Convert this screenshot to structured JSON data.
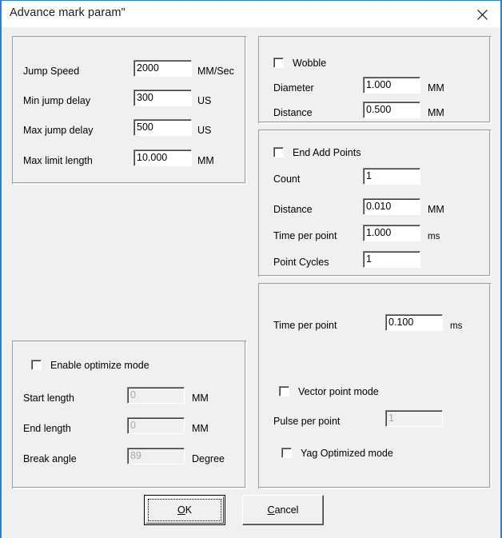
{
  "window": {
    "title": "Advance mark param\"",
    "close_icon": "close-icon",
    "accent_color": "#2f7fd1",
    "face_color": "#f0f0f0",
    "titlebar_color": "#ffffff"
  },
  "jump_group": {
    "rows": [
      {
        "label": "Jump Speed",
        "value": "2000",
        "unit": "MM/Sec",
        "disabled": false
      },
      {
        "label": "Min jump delay",
        "value": "300",
        "unit": "US",
        "disabled": false
      },
      {
        "label": "Max jump delay",
        "value": "500",
        "unit": "US",
        "disabled": false
      },
      {
        "label": "Max limit length",
        "value": "10.000",
        "unit": "MM",
        "disabled": false
      }
    ]
  },
  "wobble_group": {
    "checkbox": {
      "label": "Wobble",
      "checked": false
    },
    "rows": [
      {
        "label": "Diameter",
        "value": "1.000",
        "unit": "MM",
        "disabled": false
      },
      {
        "label": "Distance",
        "value": "0.500",
        "unit": "MM",
        "disabled": false
      }
    ]
  },
  "end_add_points_group": {
    "checkbox": {
      "label": "End Add Points",
      "checked": false
    },
    "rows": [
      {
        "label": "Count",
        "value": "1",
        "unit": "",
        "disabled": false
      },
      {
        "label": "Distance",
        "value": "0.010",
        "unit": "MM",
        "disabled": false
      },
      {
        "label": "Time per point",
        "value": "1.000",
        "unit": "ms",
        "disabled": false
      },
      {
        "label": "Point Cycles",
        "value": "1",
        "unit": "",
        "disabled": false
      }
    ]
  },
  "point_mode_group": {
    "time_per_point": {
      "label": "Time per point",
      "value": "0.100",
      "unit": "ms",
      "disabled": false
    },
    "vector_point_mode": {
      "label": "Vector point mode",
      "checked": false
    },
    "pulse_per_point": {
      "label": "Pulse per point",
      "value": "1",
      "unit": "",
      "disabled": true
    },
    "yag_optimized_mode": {
      "label": "Yag Optimized mode",
      "checked": false
    }
  },
  "optimize_group": {
    "checkbox": {
      "label": "Enable optimize mode",
      "checked": false
    },
    "rows": [
      {
        "label": "Start length",
        "value": "0",
        "unit": "MM",
        "disabled": true
      },
      {
        "label": "End length",
        "value": "0",
        "unit": "MM",
        "disabled": true
      },
      {
        "label": "Break angle",
        "value": "89",
        "unit": "Degree",
        "disabled": true
      }
    ]
  },
  "buttons": {
    "ok": {
      "accel": "O",
      "rest": "K",
      "is_default": true
    },
    "cancel": {
      "accel": "C",
      "rest": "ancel",
      "is_default": false
    }
  }
}
